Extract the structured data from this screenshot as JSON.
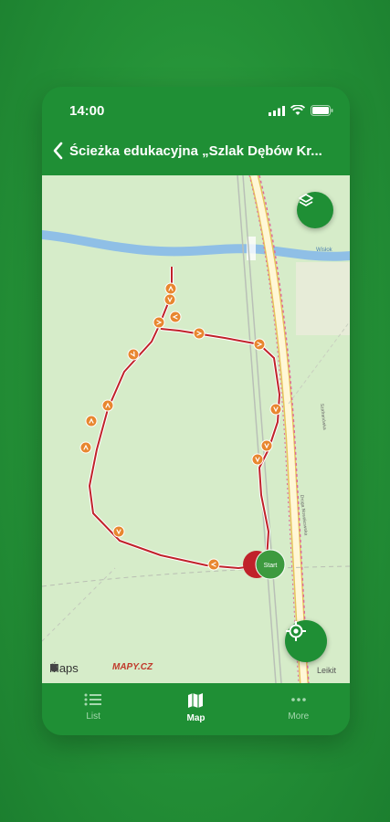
{
  "status": {
    "time": "14:00"
  },
  "nav": {
    "title": "Ścieżka edukacyjna „Szlak Dębów Kr..."
  },
  "map": {
    "attribution": "Maps",
    "provider": "MAPY.CZ",
    "legal": "Leikit",
    "start_label": "Start",
    "river_label": "Wisłok",
    "street_label_1": "Droga Nowakowska",
    "street_label_2": "Szafranówka",
    "route_color": "#c0222a",
    "marker_color": "#e8862f"
  },
  "tabs": [
    {
      "label": "List",
      "icon": "list-icon",
      "active": false
    },
    {
      "label": "Map",
      "icon": "map-icon",
      "active": true
    },
    {
      "label": "More",
      "icon": "more-icon",
      "active": false
    }
  ]
}
